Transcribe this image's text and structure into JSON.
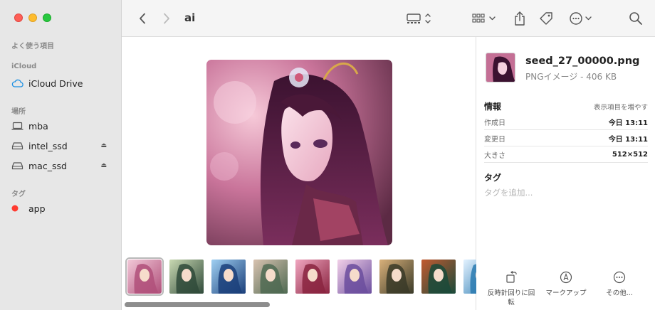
{
  "window": {
    "title": "ai"
  },
  "sidebar": {
    "favorites_label": "よく使う項目",
    "icloud_label": "iCloud",
    "icloud_drive": "iCloud Drive",
    "locations_label": "場所",
    "locations": [
      {
        "label": "mba",
        "icon": "laptop-icon"
      },
      {
        "label": "intel_ssd",
        "icon": "drive-icon"
      },
      {
        "label": "mac_ssd",
        "icon": "drive-icon"
      }
    ],
    "eject_glyph": "⏏",
    "tags_label": "タグ",
    "tags": [
      {
        "label": "app",
        "color": "#ff3b30"
      }
    ]
  },
  "thumbnails": [
    {
      "name": "seed_27_00000.png",
      "selected": true,
      "colors": [
        "#b0507a",
        "#f2c8d8"
      ]
    },
    {
      "name": "thumb-2",
      "colors": [
        "#2f4a3a",
        "#c9d9b2"
      ]
    },
    {
      "name": "thumb-3",
      "colors": [
        "#1b3f7a",
        "#9fd0f2"
      ]
    },
    {
      "name": "thumb-4",
      "colors": [
        "#4f6a52",
        "#d8c2b0"
      ]
    },
    {
      "name": "thumb-5",
      "colors": [
        "#8a2440",
        "#f0a6c0"
      ]
    },
    {
      "name": "thumb-6",
      "colors": [
        "#6b4e9e",
        "#f2d0e8"
      ]
    },
    {
      "name": "thumb-7",
      "colors": [
        "#3a3a28",
        "#d9b07a"
      ]
    },
    {
      "name": "thumb-8",
      "colors": [
        "#1a4a3a",
        "#c25a30"
      ]
    },
    {
      "name": "thumb-9",
      "colors": [
        "#2a7ab0",
        "#e4f2ff"
      ]
    }
  ],
  "inspector": {
    "file_name": "seed_27_00000.png",
    "file_kind": "PNGイメージ - 406 KB",
    "info_label": "情報",
    "show_more": "表示項目を増やす",
    "rows": [
      {
        "key": "作成日",
        "value": "今日 13:11"
      },
      {
        "key": "変更日",
        "value": "今日 13:11"
      },
      {
        "key": "大きさ",
        "value": "512×512"
      }
    ],
    "tags_label": "タグ",
    "tags_placeholder": "タグを追加...",
    "actions": [
      {
        "label": "反時計回りに回転",
        "icon": "rotate-left-icon"
      },
      {
        "label": "マークアップ",
        "icon": "markup-icon"
      },
      {
        "label": "その他...",
        "icon": "more-icon"
      }
    ]
  },
  "colors": {
    "accent": "#1a8fe3",
    "sidebar_bg": "#e7e7e7"
  }
}
